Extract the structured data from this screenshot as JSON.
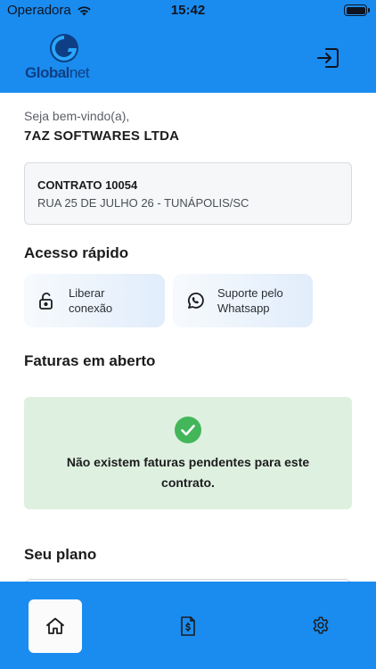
{
  "status_bar": {
    "carrier": "Operadora",
    "time": "15:42"
  },
  "brand": {
    "name_bold": "Global",
    "name_light": "net",
    "primary_color": "#1a8cf0",
    "logo_color": "#0e3f84"
  },
  "greeting": {
    "welcome": "Seja bem-vindo(a),",
    "company": "7AZ SOFTWARES LTDA"
  },
  "contract": {
    "title": "CONTRATO 10054",
    "address": "RUA 25 DE JULHO 26 - TUNÁPOLIS/SC"
  },
  "quick_access": {
    "title": "Acesso rápido",
    "items": [
      {
        "label": "Liberar\nconexão",
        "icon": "unlock-icon"
      },
      {
        "label": "Suporte pelo\nWhatsapp",
        "icon": "whatsapp-icon"
      }
    ]
  },
  "invoices": {
    "title": "Faturas em aberto",
    "empty_message": "Não existem faturas pendentes para este contrato.",
    "success_color": "#43b65a"
  },
  "plan": {
    "title": "Seu plano"
  },
  "tabbar": {
    "items": [
      {
        "name": "home",
        "icon": "home-icon",
        "active": true
      },
      {
        "name": "invoices",
        "icon": "invoice-icon",
        "active": false
      },
      {
        "name": "settings",
        "icon": "gear-icon",
        "active": false
      }
    ]
  }
}
